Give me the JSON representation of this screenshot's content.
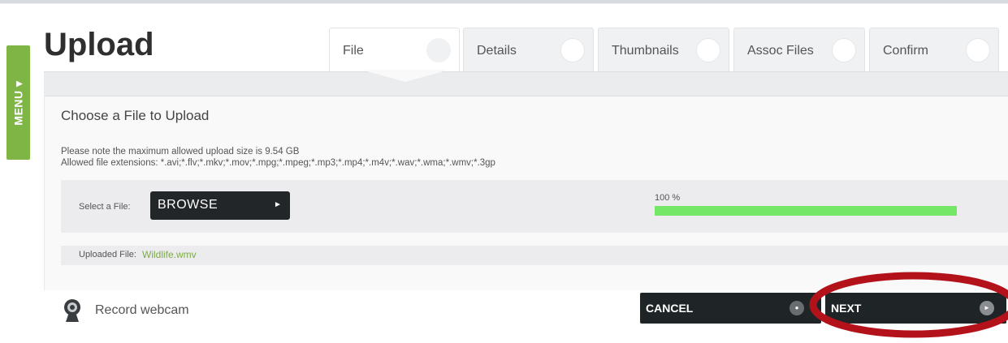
{
  "menu": {
    "label": "MENU ▾"
  },
  "page": {
    "title": "Upload"
  },
  "tabs": [
    {
      "label": "File",
      "active": true
    },
    {
      "label": "Details",
      "active": false
    },
    {
      "label": "Thumbnails",
      "active": false
    },
    {
      "label": "Assoc Files",
      "active": false
    },
    {
      "label": "Confirm",
      "active": false
    }
  ],
  "upload": {
    "heading": "Choose a File to Upload",
    "max_size_note": "Please note the maximum allowed upload size is 9.54 GB",
    "extensions_note": "Allowed file extensions: *.avi;*.flv;*.mkv;*.mov;*.mpg;*.mpeg;*.mp3;*.mp4;*.m4v;*.wav;*.wma;*.wmv;*.3gp",
    "select_label": "Select a File:",
    "browse_label": "BROWSE",
    "progress_text": "100 %",
    "progress_fraction": 1.0,
    "uploaded_label": "Uploaded File:",
    "uploaded_file": "Wildlife.wmv"
  },
  "footer": {
    "webcam_label": "Record webcam",
    "cancel_label": "CANCEL",
    "next_label": "NEXT"
  },
  "icons": {
    "browse_arrow": "play-arrow-icon",
    "webcam": "webcam-icon",
    "cancel": "close-circle-icon",
    "next": "next-circle-icon"
  },
  "colors": {
    "menu_tab": "#7fb544",
    "progress_fill": "#74e866",
    "uploaded_file_link": "#7da94a",
    "dark_button": "#1f2427",
    "annotation_circle": "#b3121a"
  }
}
